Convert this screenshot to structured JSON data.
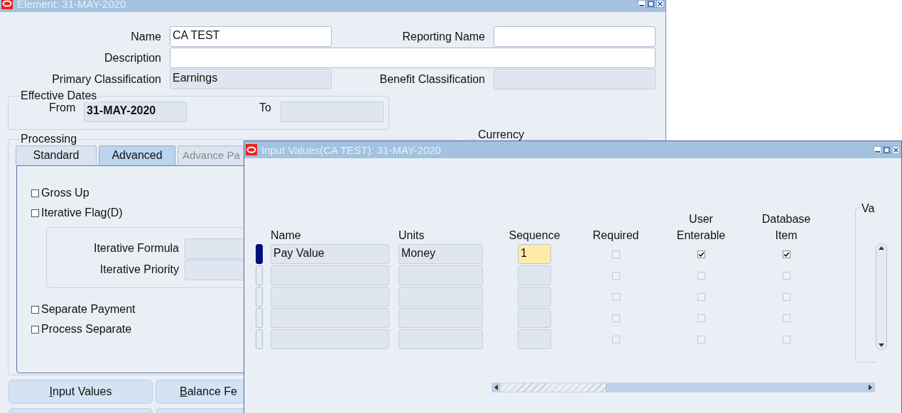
{
  "element_window": {
    "title": "Element: 31-MAY-2020",
    "fields": [
      {
        "label": "Name",
        "value": "CA TEST",
        "disabled": false
      },
      {
        "label": "Reporting Name",
        "disabled": false
      },
      {
        "label": "Description",
        "disabled": false
      },
      {
        "label": "Primary Classification",
        "value": "Earnings",
        "disabled": true
      },
      {
        "label": "Benefit Classification",
        "disabled": true
      }
    ],
    "effective_dates": {
      "label": "Effective Dates",
      "from_label": "From",
      "from_value": "31-MAY-2020",
      "to_label": "To"
    },
    "processing": {
      "label": "Processing",
      "tabs": [
        {
          "label": "Standard",
          "selected": false,
          "disabled": false
        },
        {
          "label": "Advanced",
          "selected": true,
          "disabled": false
        },
        {
          "label": "Advance Pa",
          "selected": false,
          "disabled": true
        }
      ],
      "checkboxes_top": [
        {
          "label": "Gross Up",
          "checked": false
        },
        {
          "label": "Iterative Flag(D)",
          "checked": false
        }
      ],
      "iterative_fields": [
        {
          "label": "Iterative Formula"
        },
        {
          "label": "Iterative Priority"
        }
      ],
      "checkboxes_bottom": [
        {
          "label": "Separate Payment",
          "checked": false
        },
        {
          "label": "Process Separate",
          "checked": false
        }
      ]
    },
    "currency": {
      "label": "Currency"
    },
    "button_rows": [
      {
        "buttons": [
          {
            "kind": "labeled",
            "label": "Input Values"
          },
          {
            "kind": "labeled",
            "label": "Balance Fe"
          }
        ]
      },
      {
        "buttons": [
          {
            "kind": "blank"
          },
          {
            "kind": "blank"
          }
        ]
      }
    ]
  },
  "input_values_window": {
    "title": "Input Values(CA TEST): 31-MAY-2020",
    "columns": [
      {
        "label": "Name"
      },
      {
        "label": "Units"
      },
      {
        "label": "Sequence"
      },
      {
        "label": "Required"
      },
      {
        "label": "User\nEnterable"
      },
      {
        "label": "Database\nItem"
      }
    ],
    "rows": [
      {
        "selected": true,
        "name": "Pay Value",
        "units": "Money",
        "sequence": "1",
        "required": false,
        "user_enterable": true,
        "database_item": true
      },
      {
        "selected": false,
        "required": false,
        "user_enterable": false,
        "database_item": false
      },
      {
        "selected": false,
        "required": false,
        "user_enterable": false,
        "database_item": false
      },
      {
        "selected": false,
        "required": false,
        "user_enterable": false,
        "database_item": false
      },
      {
        "selected": false,
        "required": false,
        "user_enterable": false,
        "database_item": false
      }
    ],
    "group_label": "Va"
  }
}
